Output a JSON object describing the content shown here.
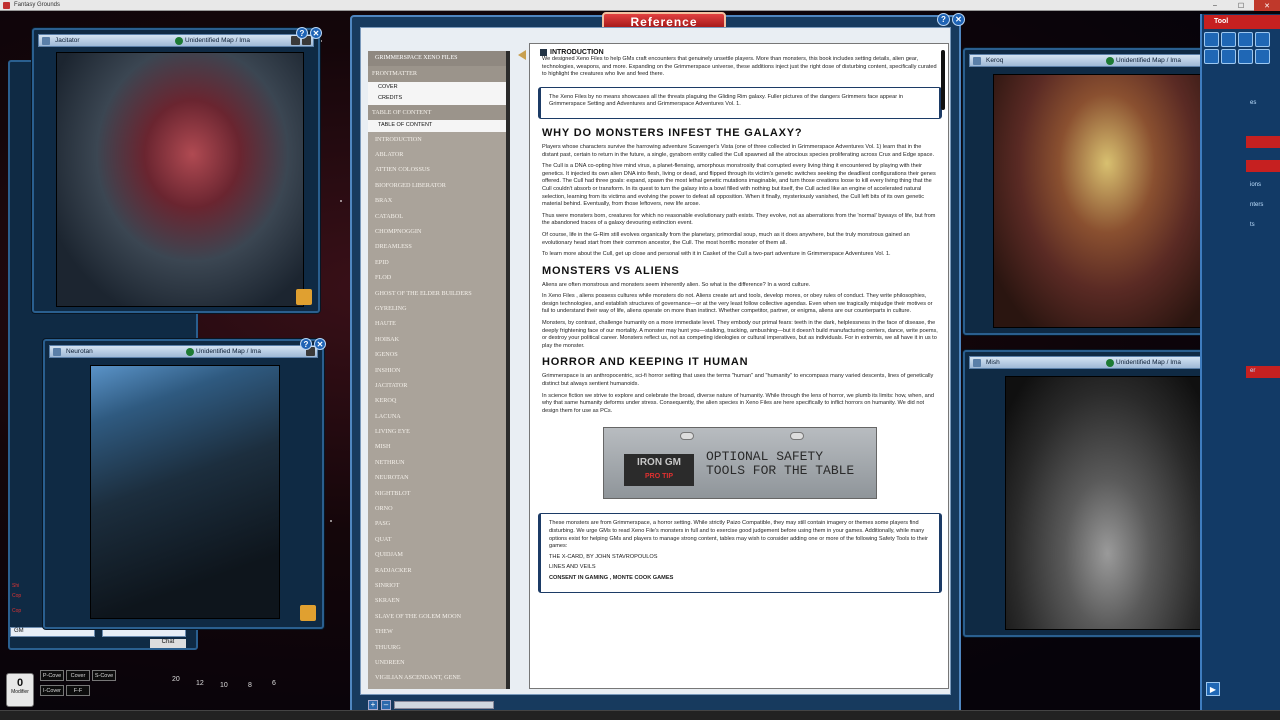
{
  "window": {
    "title": "Fantasy Grounds",
    "btn_min": "–",
    "btn_max": "☐",
    "btn_close": "✕"
  },
  "windows": {
    "jacitator": {
      "name": "Jacitator",
      "map": "Unidentified Map / Ima"
    },
    "neurotan": {
      "name": "Neurotan",
      "map": "Unidentified Map / Ima"
    },
    "keroq": {
      "name": "Keroq",
      "map": "Unidentified Map / Ima"
    },
    "mish": {
      "name": "Mish",
      "map": "Unidentified Map / Ima"
    }
  },
  "window_buttons": {
    "help": "?",
    "close": "✕"
  },
  "chat": {
    "identity": "GM",
    "send_label": "Chat",
    "lines": [
      "Shi",
      "Cop",
      "Cop"
    ]
  },
  "modifier": {
    "value": "0",
    "label": "Modifier"
  },
  "hotkeys": [
    "P-Cove",
    "Cover",
    "S-Cove",
    "I-Cover",
    "F-F"
  ],
  "dice": [
    "20",
    "12",
    "10",
    "8",
    "6"
  ],
  "tool": {
    "title": "Tool",
    "labels": [
      "es",
      "ions",
      "nters",
      "ts",
      "er"
    ],
    "play": "▶"
  },
  "reference": {
    "title": "Reference",
    "help": "?",
    "close": "✕",
    "toc": [
      {
        "label": "Grimmerspace Xeno Files",
        "kind": "head"
      },
      {
        "label": "Frontmatter",
        "kind": "group"
      },
      {
        "label": "Cover",
        "kind": "sub"
      },
      {
        "label": "Credits",
        "kind": "sub"
      },
      {
        "label": "Table of Content",
        "kind": "group"
      },
      {
        "label": "Table of Content",
        "kind": "sub"
      },
      {
        "label": "Introduction",
        "kind": "item"
      },
      {
        "label": "Ablator",
        "kind": "item"
      },
      {
        "label": "Attien Colossus",
        "kind": "item"
      },
      {
        "label": "Bioforged Liberator",
        "kind": "item"
      },
      {
        "label": "Brax",
        "kind": "item"
      },
      {
        "label": "Catabol",
        "kind": "item"
      },
      {
        "label": "Chompnoggin",
        "kind": "item"
      },
      {
        "label": "Dreamless",
        "kind": "item"
      },
      {
        "label": "Epid",
        "kind": "item"
      },
      {
        "label": "Flod",
        "kind": "item"
      },
      {
        "label": "Ghost of the Elder Builders",
        "kind": "item"
      },
      {
        "label": "Gyreling",
        "kind": "item"
      },
      {
        "label": "Haute",
        "kind": "item"
      },
      {
        "label": "Hoibak",
        "kind": "item"
      },
      {
        "label": "Igenos",
        "kind": "item"
      },
      {
        "label": "Inshion",
        "kind": "item"
      },
      {
        "label": "Jacitator",
        "kind": "item"
      },
      {
        "label": "Keroq",
        "kind": "item"
      },
      {
        "label": "Lacuna",
        "kind": "item"
      },
      {
        "label": "Living Eye",
        "kind": "item"
      },
      {
        "label": "Mish",
        "kind": "item"
      },
      {
        "label": "Nethrun",
        "kind": "item"
      },
      {
        "label": "Neurotan",
        "kind": "item"
      },
      {
        "label": "Nightblot",
        "kind": "item"
      },
      {
        "label": "Orno",
        "kind": "item"
      },
      {
        "label": "Pasg",
        "kind": "item"
      },
      {
        "label": "Quat",
        "kind": "item"
      },
      {
        "label": "Quidjam",
        "kind": "item"
      },
      {
        "label": "Radjacker",
        "kind": "item"
      },
      {
        "label": "Sinriot",
        "kind": "item"
      },
      {
        "label": "Skraen",
        "kind": "item"
      },
      {
        "label": "Slave of the Golem Moon",
        "kind": "item"
      },
      {
        "label": "Thew",
        "kind": "item"
      },
      {
        "label": "Thuurg",
        "kind": "item"
      },
      {
        "label": "Undreen",
        "kind": "item"
      },
      {
        "label": "Vigilian Ascendant, Gene",
        "kind": "item"
      }
    ],
    "section_title": "INTRODUCTION",
    "intro_p": "We designed Xeno Files to help GMs craft encounters that genuinely unsettle players. More than monsters, this book includes setting details, alien gear, technologies, weapons, and more. Expanding on the Grimmerspace universe, these additions inject just the right dose of disturbing content, specifically curated to highlight the creatures who live and feed there.",
    "box1": "The Xeno Files by no means showcases all the threats plaguing the Gliding Rim galaxy. Fuller pictures of the dangers Grimmers face appear in Grimmerspace Setting and Adventures and Grimmerspace Adventures Vol. 1.",
    "h_why": "WHY DO MONSTERS INFEST THE GALAXY?",
    "why_p1": "Players whose characters survive the harrowing adventure Scavenger's Vista (one of three collected in Grimmerspace Adventures Vol. 1) learn that in the distant past, certain to return in the future, a single, gyraborn entity called the Cull spawned all the atrocious species proliferating across Crux and Edge space.",
    "why_p2": "The Cull is a DNA co-opting hive mind virus, a planet-flensing, amorphous monstrosity that corrupted every living thing it encountered by playing with their genetics. It injected its own alien DNA into flesh, living or dead, and flipped through its victim's genetic switches seeking the deadliest configurations their genes offered. The Cull had three goals: expand, spawn the most lethal genetic mutations imaginable, and turn those creations loose to kill every living thing that the Cull couldn't absorb or transform. In its quest to turn the galaxy into a bowl filled with nothing but itself, the Cull acted like an engine of accelerated natural selection, learning from its victims and evolving the power to defeat all opposition. When it finally, mysteriously vanished, the Cull left bits of its own genetic material behind. Eventually, from those leftovers, new life arose.",
    "why_p3": "Thus were monsters born, creatures for which no reasonable evolutionary path exists. They evolve, not as aberrations from the 'normal' byways of life, but from the abandoned traces of a galaxy devouring extinction event.",
    "why_p4": "Of course, life in the G-Rim still evolves organically from the planetary, primordial soup, much as it does anywhere, but the truly monstrous gained an evolutionary head start from their common ancestor, the Cull. The most horrific monster of them all.",
    "why_p5": "To learn more about the Cull, get up close and personal with it in Casket of the Cull a two-part adventure in Grimmerspace Adventures Vol. 1.",
    "h_vs": "MONSTERS VS ALIENS",
    "vs_p1": "Aliens are often monstrous and monsters seem inherently alien. So what is the difference? In a word culture.",
    "vs_p2": "In Xeno Files , aliens possess cultures while monsters do not. Aliens create art and tools, develop mores, or obey rules of conduct. They write philosophies, design technologies, and establish structures of governance—or at the very least follow collective agendas. Even when we tragically misjudge their motives or fail to understand their way of life, aliens operate on more than instinct. Whether competitor, partner, or enigma, aliens are our counterparts in culture.",
    "vs_p3": "Monsters, by contrast, challenge humanity on a more immediate level. They embody our primal fears: teeth in the dark, helplessness in the face of disease, the deeply frightening face of our mortality. A monster may hunt you—stalking, tracking, ambushing—but it doesn't build manufacturing centers, dance, write poems, or destroy your political career. Monsters reflect us, not as competing ideologies or cultural imperatives, but as individuals. For in extremis, we all have it in us to play the monster.",
    "h_horror": "HORROR AND KEEPING IT HUMAN",
    "horror_p1": "Grimmerspace is an anthropocentric, sci-fi horror setting that uses the terms \"human\" and \"humanity\" to encompass many varied descents, lines of genetically distinct but always sentient humanoids.",
    "horror_p2": "In science fiction we strive to explore and celebrate the broad, diverse nature of humanity. While through the lens of horror, we plumb its limits: how, when, and why that same humanity deforms under stress. Consequently, the alien species in Xeno Files are here specifically to inflict horrors on humanity. We did not design them for use as PCs.",
    "protip_logo": "IRON GM",
    "protip_sub": "PRO TIP",
    "protip_text_1": "OPTIONAL SAFETY",
    "protip_text_2": "TOOLS FOR THE TABLE",
    "box2_p": "These monsters are from Grimmerspace, a horror setting. While strictly Paizo Compatible, they may still contain imagery or themes some players find disturbing. We urge GMs to read Xeno File's monsters in full and to exercise good judgement before using them in your games. Additionally, while many options exist for helping GMs and players to manage strong content, tables may wish to consider adding one or more of the following Safety Tools to their games:",
    "box2_l1": "THE X-CARD, BY JOHN STAVROPOULOS",
    "box2_l2": "LINES AND VEILS",
    "box2_l3": "CONSENT IN GAMING , MONTE COOK GAMES",
    "bottom_plus": "+",
    "bottom_minus": "–"
  }
}
